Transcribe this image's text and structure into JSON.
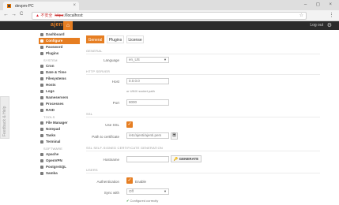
{
  "browser": {
    "tab_title": "devpm-PC",
    "nav_back": "←",
    "nav_forward": "→",
    "nav_reload": "C",
    "insecure_label": "不安全",
    "url_scheme": "https",
    "url_rest": "://localhost:",
    "close_glyph": "×",
    "win_controls": "– ◻ ×",
    "star_glyph": "☆",
    "menu_glyph": "⋮"
  },
  "app": {
    "logo": "ajenti",
    "home_glyph": "⌂",
    "logout_label": "Log out",
    "settings_glyph": "⚙"
  },
  "sidebar": {
    "top": [
      {
        "label": "Dashboard",
        "icon": "dashboard-icon"
      },
      {
        "label": "Configure",
        "icon": "configure-icon",
        "active": true
      },
      {
        "label": "Password",
        "icon": "key-icon"
      },
      {
        "label": "Plugins",
        "icon": "puzzle-icon"
      }
    ],
    "system_title": "SYSTEM",
    "system": [
      {
        "label": "Cron",
        "icon": "clock-icon"
      },
      {
        "label": "Date & Time",
        "icon": "calendar-icon"
      },
      {
        "label": "Filesystems",
        "icon": "hdd-icon"
      },
      {
        "label": "Hosts",
        "icon": "hosts-icon"
      },
      {
        "label": "Logs",
        "icon": "logs-icon"
      },
      {
        "label": "Nameservers",
        "icon": "nameservers-icon"
      },
      {
        "label": "Processes",
        "icon": "processes-icon"
      },
      {
        "label": "RAID",
        "icon": "raid-icon"
      }
    ],
    "tools_title": "TOOLS",
    "tools": [
      {
        "label": "File Manager",
        "icon": "folder-icon"
      },
      {
        "label": "Notepad",
        "icon": "notepad-icon"
      },
      {
        "label": "Tasks",
        "icon": "tasks-icon"
      },
      {
        "label": "Terminal",
        "icon": "terminal-icon"
      }
    ],
    "software_title": "SOFTWARE",
    "software": [
      {
        "label": "Apache",
        "icon": "apache-icon"
      },
      {
        "label": "OpenVPN",
        "icon": "vpn-icon"
      },
      {
        "label": "PostgreSQL",
        "icon": "database-icon"
      },
      {
        "label": "Samba",
        "icon": "samba-icon"
      }
    ]
  },
  "feedback_label": "Feedback & Help",
  "tabs": [
    {
      "label": "General",
      "active": true
    },
    {
      "label": "Plugins",
      "active": false
    },
    {
      "label": "License",
      "active": false
    }
  ],
  "general": {
    "section_title": "GENERAL",
    "language_label": "Language",
    "language_value": "en_US"
  },
  "http": {
    "section_title": "HTTP SERVER",
    "host_label": "Host",
    "host_value": "0.0.0.0",
    "unix_hint": "or UNIX socket path",
    "port_label": "Port",
    "port_value": "8000"
  },
  "ssl": {
    "section_title": "SSL",
    "use_ssl_label": "Use SSL",
    "use_ssl_checked": true,
    "cert_label": "Path to certificate",
    "cert_value": "/etc/ajenti/ajenti.pem",
    "file_glyph": "🗎"
  },
  "cert_gen": {
    "section_title": "SSL SELF-SIGNED CERTIFICATE GENERATION",
    "hostname_label": "Hostname",
    "hostname_value": "",
    "generate_label": "GENERATE",
    "generate_glyph": "🔑"
  },
  "users": {
    "section_title": "USERS",
    "auth_label": "Authentication",
    "auth_checked": true,
    "enable_label": "Enable",
    "sync_label": "Sync with",
    "sync_value": "Off",
    "configured_text": "Configured correctly",
    "configured_glyph": "✔"
  },
  "colors": {
    "accent": "#e67e22",
    "header_bg": "#2b2b2b"
  }
}
